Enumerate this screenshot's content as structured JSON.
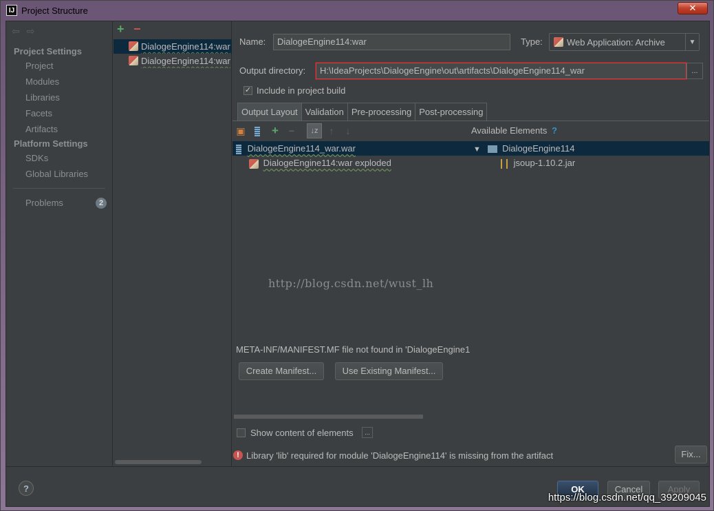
{
  "window": {
    "title": "Project Structure",
    "close_glyph": "✕",
    "app_icon": "IJ"
  },
  "sidebar": {
    "back_glyph": "⇦",
    "forward_glyph": "⇨",
    "project_settings_label": "Project Settings",
    "project_settings_items": [
      "Project",
      "Modules",
      "Libraries",
      "Facets",
      "Artifacts"
    ],
    "platform_settings_label": "Platform Settings",
    "platform_settings_items": [
      "SDKs",
      "Global Libraries"
    ],
    "problems_label": "Problems",
    "problems_count": "2"
  },
  "artifacts": {
    "add_glyph": "+",
    "remove_glyph": "−",
    "items": [
      "DialogeEngine114:war",
      "DialogeEngine114:war"
    ]
  },
  "form": {
    "name_label": "Name:",
    "name_value": "DialogeEngine114:war",
    "type_label": "Type:",
    "type_value": "Web Application: Archive",
    "output_label": "Output directory:",
    "output_value": "H:\\IdeaProjects\\DialogeEngine\\out\\artifacts\\DialogeEngine114_war",
    "browse_label": "...",
    "include_label": "Include in project build",
    "include_checked": true
  },
  "tabs": [
    "Output Layout",
    "Validation",
    "Pre-processing",
    "Post-processing"
  ],
  "layout": {
    "available_label": "Available Elements",
    "help_glyph": "?",
    "root_item": "DialogeEngine114_war.war",
    "child_item": "DialogeEngine114:war exploded",
    "avail_root": "DialogeEngine114",
    "avail_child": "jsoup-1.10.2.jar",
    "watermark": "http://blog.csdn.net/wust_lh"
  },
  "manifest": {
    "message": "META-INF/MANIFEST.MF file not found in 'DialogeEngine1",
    "create_label": "Create Manifest...",
    "use_existing_label": "Use Existing Manifest..."
  },
  "show_content_label": "Show content of elements",
  "show_content_more": "...",
  "error": {
    "message": "Library 'lib' required for module 'DialogeEngine114' is missing from the artifact",
    "fix_label": "Fix..."
  },
  "footer": {
    "help": "?",
    "ok_label": "OK",
    "cancel_label": "Cancel",
    "apply_label": "Apply",
    "watermark": "https://blog.csdn.net/qq_39209045"
  },
  "colors": {
    "selection": "#0d293e",
    "panel": "#3c3f41",
    "error": "#c75450",
    "add": "#59a869"
  }
}
